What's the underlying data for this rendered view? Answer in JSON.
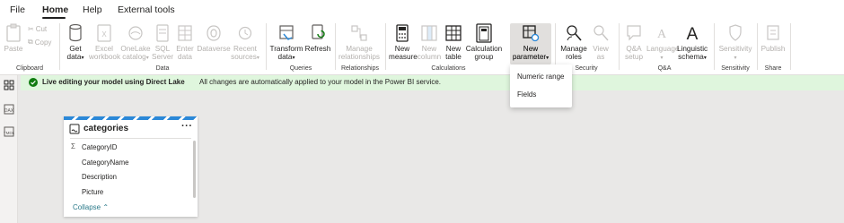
{
  "menu": {
    "tabs": [
      {
        "label": "File"
      },
      {
        "label": "Home"
      },
      {
        "label": "Help"
      },
      {
        "label": "External tools"
      }
    ]
  },
  "ribbon": {
    "clipboard": {
      "paste": "Paste",
      "cut": "Cut",
      "copy": "Copy",
      "group": "Clipboard"
    },
    "data": {
      "get_data": [
        "Get",
        "data"
      ],
      "excel": [
        "Excel",
        "workbook"
      ],
      "onelake": [
        "OneLake",
        "catalog"
      ],
      "sql": [
        "SQL",
        "Server"
      ],
      "enter": [
        "Enter",
        "data"
      ],
      "dataverse": [
        "Dataverse"
      ],
      "recent": [
        "Recent",
        "sources"
      ],
      "group": "Data"
    },
    "queries": {
      "transform": [
        "Transform",
        "data"
      ],
      "refresh": [
        "Refresh"
      ],
      "group": "Queries"
    },
    "relationships": {
      "manage": [
        "Manage",
        "relationships"
      ],
      "group": "Relationships"
    },
    "calculations": {
      "new_measure": [
        "New",
        "measure"
      ],
      "new_column": [
        "New",
        "column"
      ],
      "new_table": [
        "New",
        "table"
      ],
      "calc_group": [
        "Calculation",
        "group"
      ],
      "new_parameter": [
        "New",
        "parameter"
      ],
      "group": "Calculations"
    },
    "security": {
      "manage_roles": [
        "Manage",
        "roles"
      ],
      "view_as": [
        "View",
        "as"
      ],
      "group": "Security"
    },
    "qa": {
      "qa_setup": [
        "Q&A",
        "setup"
      ],
      "language": [
        "Language"
      ],
      "linguistic": [
        "Linguistic",
        "schema"
      ],
      "group": "Q&A"
    },
    "sensitivity": {
      "label": [
        "Sensitivity"
      ],
      "group": "Sensitivity"
    },
    "share": {
      "publish": [
        "Publish"
      ],
      "group": "Share"
    }
  },
  "dropdown": {
    "items": [
      {
        "label": "Numeric range"
      },
      {
        "label": "Fields"
      }
    ]
  },
  "banner": {
    "bold": "Live editing your model using Direct Lake",
    "message": "All changes are automatically applied to your model in the Power BI service."
  },
  "table_card": {
    "title": "categories",
    "more": "···",
    "fields": [
      {
        "name": "CategoryID",
        "sigma": "Σ"
      },
      {
        "name": "CategoryName",
        "sigma": ""
      },
      {
        "name": "Description",
        "sigma": ""
      },
      {
        "name": "Picture",
        "sigma": ""
      }
    ],
    "collapse": "Collapse"
  },
  "colors": {
    "accent_blue": "#2b88d8",
    "banner_green": "#dff6dd",
    "success_green": "#107c10",
    "canvas": "#e9e8e7",
    "disabled": "#b3b0ad"
  }
}
